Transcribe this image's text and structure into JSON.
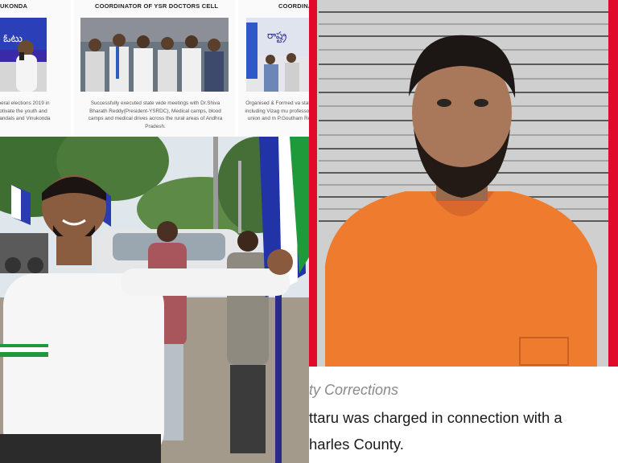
{
  "cards": [
    {
      "title": "UKONDA",
      "description": "eneral elections 2019 in Motivate the youth and mandals and Vinukonda"
    },
    {
      "title": "COORDINATOR OF YSR DOCTORS CELL",
      "description": "Successfully executed state wide meetings with Dr.Shiva Bharath Reddy(President-YSRDC), Medical camps, blood camps and medical drives across the rural areas of Andhra Pradesh."
    },
    {
      "title": "COORDINA",
      "description": "Organised & Formed va state including Vizag mu professors union and m P.Goutham Re"
    }
  ],
  "news": {
    "section_label": "ty Corrections",
    "line_1": "ttaru was charged in connection with a",
    "line_2": "harles County."
  },
  "colors": {
    "border_red": "#e10a2a",
    "jumpsuit_orange": "#ee7b2e",
    "flag_blue": "#2233a8",
    "flag_green": "#1f9a3a"
  }
}
